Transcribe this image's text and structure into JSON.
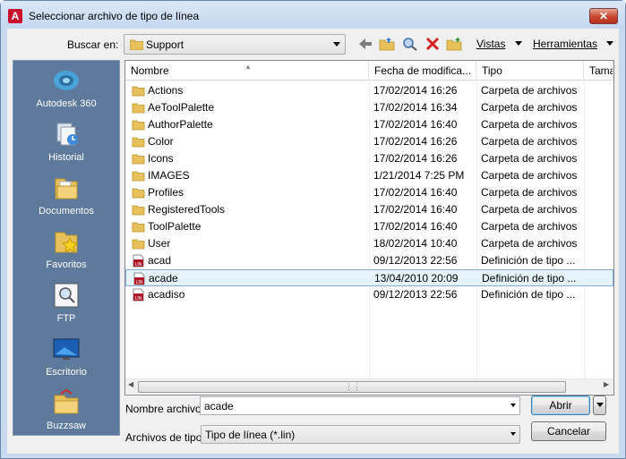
{
  "window": {
    "title": "Seleccionar archivo de tipo de línea",
    "app_icon": "A",
    "close_glyph": "✕"
  },
  "lookin": {
    "label": "Buscar en:",
    "value": "Support"
  },
  "toolbar": {
    "views_label": "Vistas",
    "tools_label": "Herramientas"
  },
  "places": [
    {
      "label": "Autodesk 360",
      "icon": "cloud-icon"
    },
    {
      "label": "Historial",
      "icon": "history-icon"
    },
    {
      "label": "Documentos",
      "icon": "documents-icon"
    },
    {
      "label": "Favoritos",
      "icon": "favorites-icon"
    },
    {
      "label": "FTP",
      "icon": "ftp-icon"
    },
    {
      "label": "Escritorio",
      "icon": "desktop-icon"
    },
    {
      "label": "Buzzsaw",
      "icon": "buzzsaw-icon"
    }
  ],
  "columns": {
    "name": "Nombre",
    "date": "Fecha de modifica...",
    "type": "Tipo",
    "size": "Tama"
  },
  "files": [
    {
      "name": "Actions",
      "date": "17/02/2014 16:26",
      "type": "Carpeta de archivos",
      "kind": "folder"
    },
    {
      "name": "AeToolPalette",
      "date": "17/02/2014 16:34",
      "type": "Carpeta de archivos",
      "kind": "folder"
    },
    {
      "name": "AuthorPalette",
      "date": "17/02/2014 16:40",
      "type": "Carpeta de archivos",
      "kind": "folder"
    },
    {
      "name": "Color",
      "date": "17/02/2014 16:26",
      "type": "Carpeta de archivos",
      "kind": "folder"
    },
    {
      "name": "Icons",
      "date": "17/02/2014 16:26",
      "type": "Carpeta de archivos",
      "kind": "folder"
    },
    {
      "name": "IMAGES",
      "date": "1/21/2014 7:25 PM",
      "type": "Carpeta de archivos",
      "kind": "folder"
    },
    {
      "name": "Profiles",
      "date": "17/02/2014 16:40",
      "type": "Carpeta de archivos",
      "kind": "folder"
    },
    {
      "name": "RegisteredTools",
      "date": "17/02/2014 16:40",
      "type": "Carpeta de archivos",
      "kind": "folder"
    },
    {
      "name": "ToolPalette",
      "date": "17/02/2014 16:40",
      "type": "Carpeta de archivos",
      "kind": "folder"
    },
    {
      "name": "User",
      "date": "18/02/2014 10:40",
      "type": "Carpeta de archivos",
      "kind": "folder"
    },
    {
      "name": "acad",
      "date": "09/12/2013 22:56",
      "type": "Definición de tipo ...",
      "kind": "lin"
    },
    {
      "name": "acade",
      "date": "13/04/2010 20:09",
      "type": "Definición de tipo ...",
      "kind": "lin",
      "selected": true
    },
    {
      "name": "acadiso",
      "date": "09/12/2013 22:56",
      "type": "Definición de tipo ...",
      "kind": "lin"
    }
  ],
  "filename": {
    "label": "Nombre archivo:",
    "value": "acade"
  },
  "filetype": {
    "label": "Archivos de tipo:",
    "value": "Tipo de línea (*.lin)"
  },
  "buttons": {
    "open": "Abrir",
    "cancel": "Cancelar"
  },
  "colors": {
    "folder": "#e8c15a",
    "lin_icon": "#b0182a",
    "places_bg": "#5d7a9c",
    "selection": "#e5f3fb"
  }
}
